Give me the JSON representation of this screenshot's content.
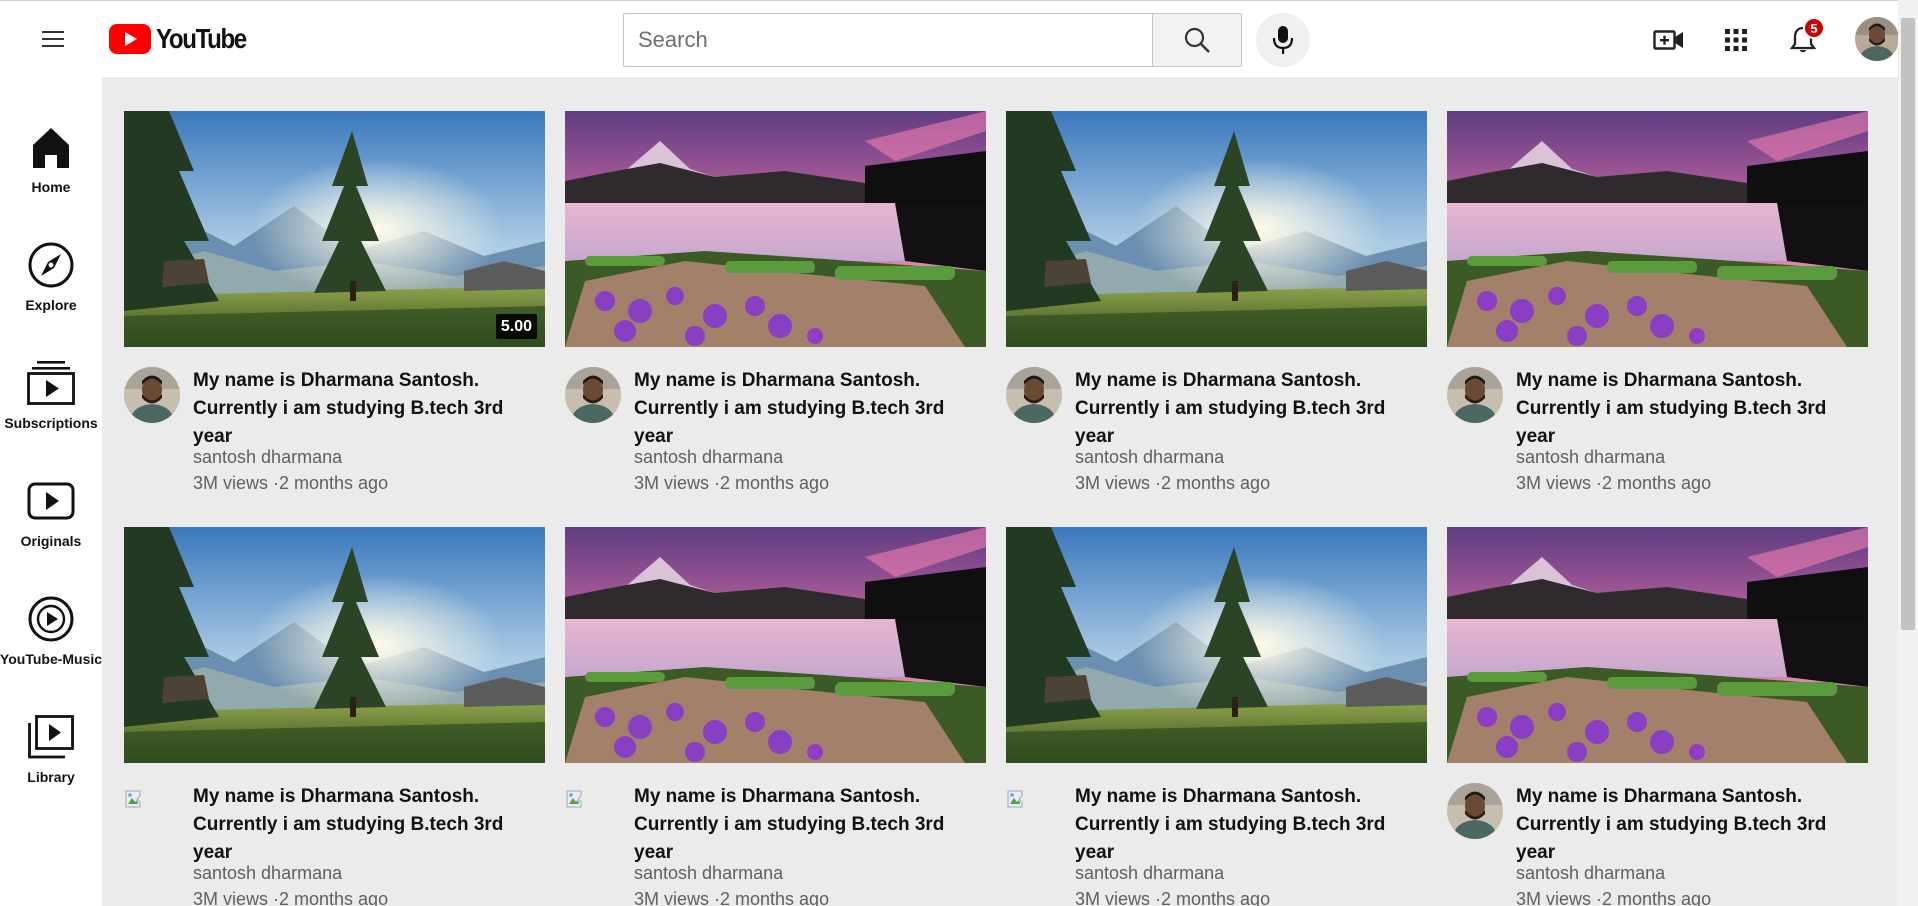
{
  "header": {
    "logo_text": "YouTube",
    "search_placeholder": "Search",
    "notification_count": "5",
    "icons": [
      "menu-icon",
      "youtube-logo-icon",
      "search-icon",
      "mic-icon",
      "create-video-icon",
      "apps-grid-icon",
      "bell-icon"
    ]
  },
  "sidebar": {
    "items": [
      {
        "label": "Home",
        "icon": "home-icon"
      },
      {
        "label": "Explore",
        "icon": "compass-icon"
      },
      {
        "label": "Subscriptions",
        "icon": "subscriptions-icon"
      },
      {
        "label": "Originals",
        "icon": "play-box-icon"
      },
      {
        "label": "YouTube-Music",
        "icon": "music-play-icon"
      },
      {
        "label": "Library",
        "icon": "library-icon"
      }
    ]
  },
  "videos": [
    {
      "title": "My name is Dharmana Santosh. Currently i am studying B.tech 3rd year",
      "channel": "santosh dharmana",
      "meta": "3M views ·2 months ago",
      "duration": "5.00",
      "thumbnail": "forest-sun",
      "avatar": "photo"
    },
    {
      "title": "My name is Dharmana Santosh. Currently i am studying B.tech 3rd year",
      "channel": "santosh dharmana",
      "meta": "3M views ·2 months ago",
      "duration": "",
      "thumbnail": "pink-lake",
      "avatar": "photo"
    },
    {
      "title": "My name is Dharmana Santosh. Currently i am studying B.tech 3rd year",
      "channel": "santosh dharmana",
      "meta": "3M views ·2 months ago",
      "duration": "",
      "thumbnail": "forest-sun",
      "avatar": "photo"
    },
    {
      "title": "My name is Dharmana Santosh. Currently i am studying B.tech 3rd year",
      "channel": "santosh dharmana",
      "meta": "3M views ·2 months ago",
      "duration": "",
      "thumbnail": "pink-lake",
      "avatar": "photo"
    },
    {
      "title": "My name is Dharmana Santosh. Currently i am studying B.tech 3rd year",
      "channel": "santosh dharmana",
      "meta": "3M views ·2 months ago",
      "duration": "",
      "thumbnail": "forest-sun",
      "avatar": "broken"
    },
    {
      "title": "My name is Dharmana Santosh. Currently i am studying B.tech 3rd year",
      "channel": "santosh dharmana",
      "meta": "3M views ·2 months ago",
      "duration": "",
      "thumbnail": "pink-lake",
      "avatar": "broken"
    },
    {
      "title": "My name is Dharmana Santosh. Currently i am studying B.tech 3rd year",
      "channel": "santosh dharmana",
      "meta": "3M views ·2 months ago",
      "duration": "",
      "thumbnail": "forest-sun",
      "avatar": "broken"
    },
    {
      "title": "My name is Dharmana Santosh. Currently i am studying B.tech 3rd year",
      "channel": "santosh dharmana",
      "meta": "3M views ·2 months ago",
      "duration": "",
      "thumbnail": "pink-lake",
      "avatar": "photo"
    }
  ],
  "colors": {
    "brand_red": "#ff0000",
    "badge_red": "#cc0000",
    "background": "#ebebeb",
    "secondary_text": "#606060"
  }
}
